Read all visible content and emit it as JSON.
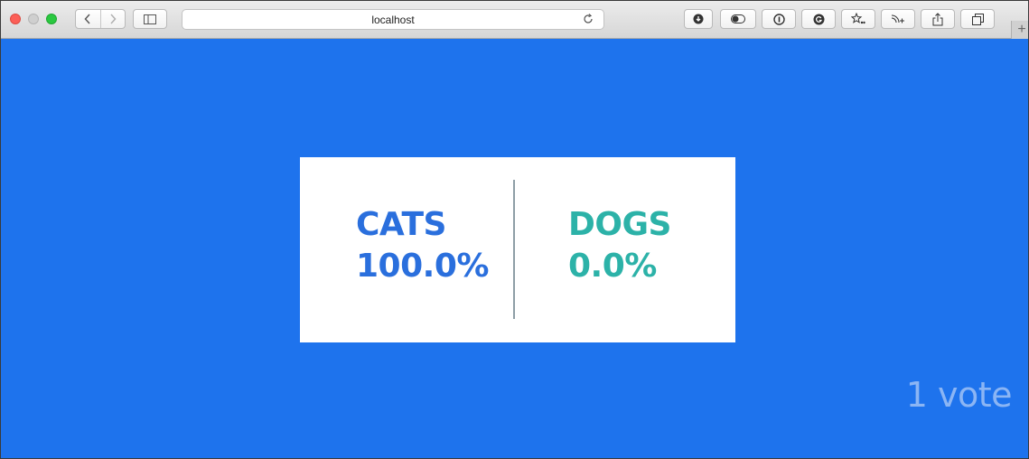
{
  "browser": {
    "url": "localhost",
    "new_tab_symbol": "+",
    "icons": [
      "back-icon",
      "forward-icon",
      "sidebar-icon",
      "reload-icon",
      "download-icon",
      "toggle-icon",
      "password-icon",
      "grammarly-icon",
      "favorites-icon",
      "rss-icon",
      "share-icon",
      "tabs-icon"
    ]
  },
  "poll": {
    "option_a": {
      "name": "CATS",
      "percent": "100.0%"
    },
    "option_b": {
      "name": "DOGS",
      "percent": "0.0%"
    },
    "votes_label": "1 vote"
  },
  "colors": {
    "background": "#1e73ed",
    "option_a": "#2a6fdd",
    "option_b": "#2cb2a8",
    "votes": "#8bb5f4"
  }
}
